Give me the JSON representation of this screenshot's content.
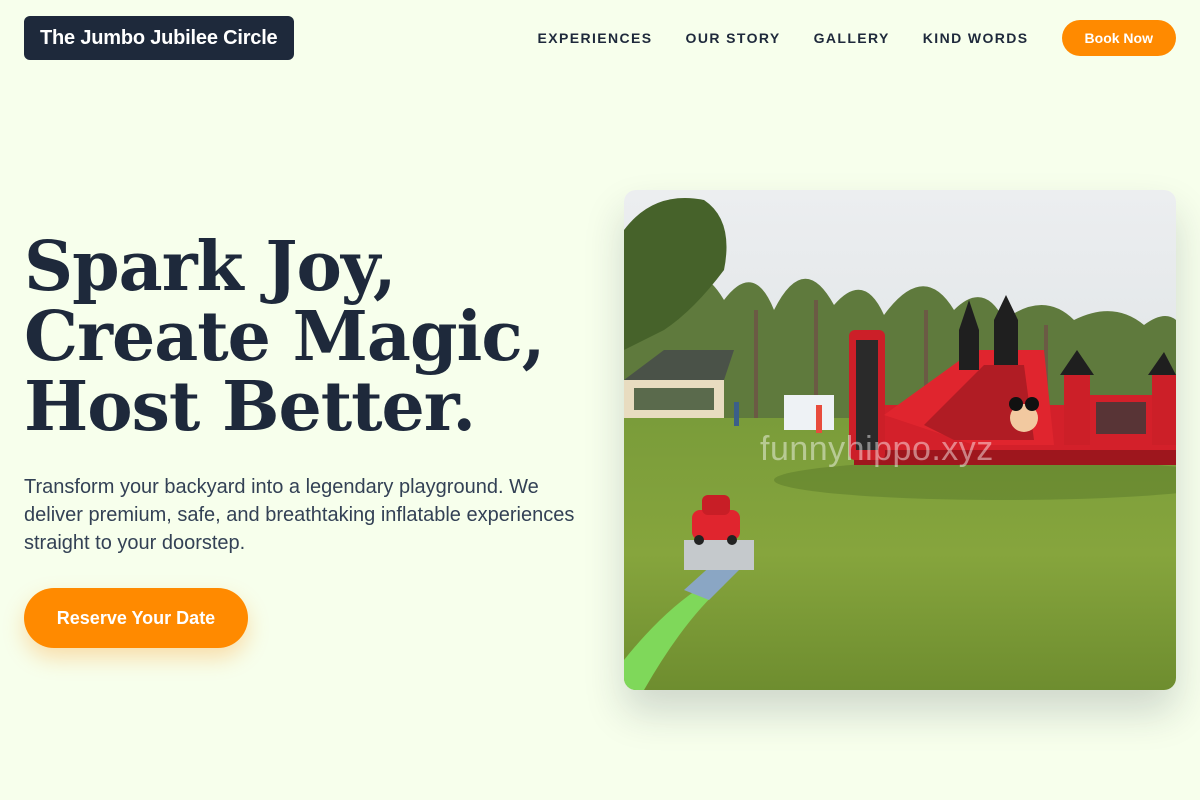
{
  "header": {
    "logo_text": "The Jumbo Jubilee Circle",
    "nav": [
      "EXPERIENCES",
      "OUR STORY",
      "GALLERY",
      "KIND WORDS"
    ],
    "book_label": "Book Now"
  },
  "hero": {
    "title_lines": [
      "Spark Joy,",
      "Create Magic,",
      "Host Better."
    ],
    "description": "Transform your backyard into a legendary playground. We deliver premium, safe, and breathtaking inflatable experiences straight to your doorstep.",
    "cta_label": "Reserve Your Date",
    "image": {
      "subject": "Red and black inflatable bounce castle with slide on a green lawn, with a toy car track in the foreground",
      "watermark": "funnyhippo.xyz"
    }
  },
  "colors": {
    "background": "#f7ffec",
    "navy": "#1e293b",
    "accent_orange": "#ff8a00"
  }
}
